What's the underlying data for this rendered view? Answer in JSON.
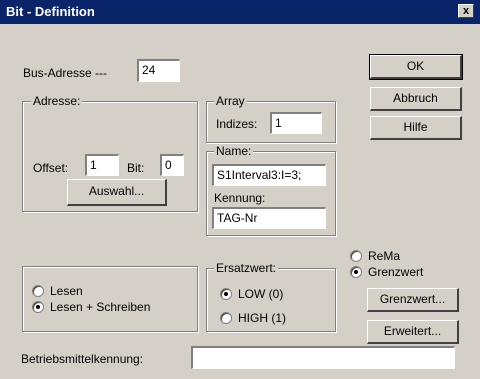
{
  "window": {
    "title": "Bit - Definition",
    "close_glyph": "x",
    "close_icon": "close-icon"
  },
  "bus": {
    "label": "Bus-Adresse ---",
    "value": "24"
  },
  "adresse": {
    "legend": "Adresse:",
    "offset_label": "Offset:",
    "offset_value": "1",
    "bit_label": "Bit:",
    "bit_value": "0",
    "auswahl_label": "Auswahl..."
  },
  "array": {
    "legend": "Array",
    "indizes_label": "Indizes:",
    "indizes_value": "1"
  },
  "name": {
    "legend": "Name:",
    "value": "S1Interval3:I=3;",
    "kennung_label": "Kennung:",
    "kennung_value": "TAG-Nr"
  },
  "buttons": {
    "ok": "OK",
    "abbruch": "Abbruch",
    "hilfe": "Hilfe",
    "grenzwert": "Grenzwert...",
    "erweitert": "Erweitert..."
  },
  "mode": {
    "options": [
      {
        "label": "ReMa",
        "checked": false
      },
      {
        "label": "Grenzwert",
        "checked": true
      }
    ]
  },
  "access": {
    "options": [
      {
        "label": "Lesen",
        "checked": false
      },
      {
        "label": "Lesen + Schreiben",
        "checked": true
      }
    ]
  },
  "ersatzwert": {
    "legend": "Ersatzwert:",
    "options": [
      {
        "label": "LOW (0)",
        "checked": true
      },
      {
        "label": "HIGH (1)",
        "checked": false
      }
    ]
  },
  "betriebsmittel": {
    "label": "Betriebsmittelkennung:",
    "value": ""
  }
}
